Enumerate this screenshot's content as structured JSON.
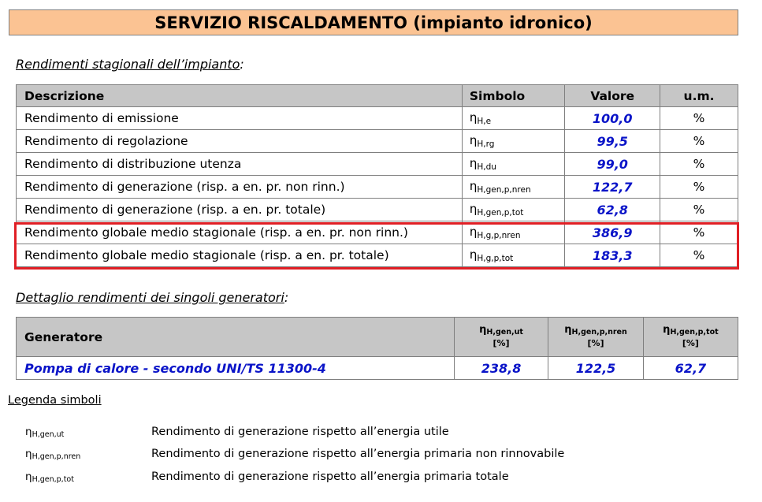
{
  "title": "SERVIZIO RISCALDAMENTO (impianto idronico)",
  "section1": {
    "label": "Rendimenti stagionali dell’impianto",
    "suffix": ":"
  },
  "table1": {
    "headers": [
      "Descrizione",
      "Simbolo",
      "Valore",
      "u.m."
    ],
    "rows": [
      {
        "desc": "Rendimento di emissione",
        "sym": "η",
        "sub": "H,e",
        "value": "100,0",
        "um": "%"
      },
      {
        "desc": "Rendimento di regolazione",
        "sym": "η",
        "sub": "H,rg",
        "value": "99,5",
        "um": "%"
      },
      {
        "desc": "Rendimento di distribuzione utenza",
        "sym": "η",
        "sub": "H,du",
        "value": "99,0",
        "um": "%"
      },
      {
        "desc": "Rendimento di generazione (risp. a en. pr. non rinn.)",
        "sym": "η",
        "sub": "H,gen,p,nren",
        "value": "122,7",
        "um": "%"
      },
      {
        "desc": "Rendimento di generazione (risp. a en. pr. totale)",
        "sym": "η",
        "sub": "H,gen,p,tot",
        "value": "62,8",
        "um": "%"
      },
      {
        "desc": "Rendimento globale medio stagionale (risp. a en. pr. non rinn.)",
        "sym": "η",
        "sub": "H,g,p,nren",
        "value": "386,9",
        "um": "%"
      },
      {
        "desc": "Rendimento globale medio stagionale (risp. a en. pr. totale)",
        "sym": "η",
        "sub": "H,g,p,tot",
        "value": "183,3",
        "um": "%"
      }
    ]
  },
  "section2": {
    "label": "Dettaglio rendimenti dei singoli generatori",
    "suffix": ":"
  },
  "table2": {
    "header_name": "Generatore",
    "columns": [
      {
        "sym": "η",
        "sub": "H,gen,ut",
        "unit": "[%]"
      },
      {
        "sym": "η",
        "sub": "H,gen,p,nren",
        "unit": "[%]"
      },
      {
        "sym": "η",
        "sub": "H,gen,p,tot",
        "unit": "[%]"
      }
    ],
    "row": {
      "name": "Pompa di calore - secondo UNI/TS 11300-4",
      "values": [
        "238,8",
        "122,5",
        "62,7"
      ]
    }
  },
  "legend": {
    "title": "Legenda simboli",
    "items": [
      {
        "sym": "η",
        "sub": "H,gen,ut",
        "text": "Rendimento di generazione rispetto all’energia utile"
      },
      {
        "sym": "η",
        "sub": "H,gen,p,nren",
        "text": "Rendimento di generazione rispetto all’energia primaria non rinnovabile"
      },
      {
        "sym": "η",
        "sub": "H,gen,p,tot",
        "text": "Rendimento di generazione rispetto all’energia primaria totale"
      }
    ]
  },
  "colors": {
    "header_bg": "#fbc393",
    "table_header_bg": "#c6c6c6",
    "value_blue": "#0a14c8",
    "highlight_red": "#e01f25"
  }
}
